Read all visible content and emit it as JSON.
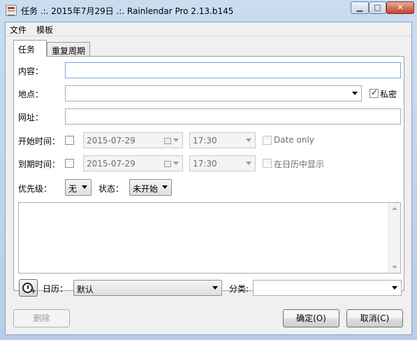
{
  "window": {
    "title": "任务 .:. 2015年7月29日 .:. Rainlendar Pro 2.13.b145"
  },
  "title_buttons": {
    "minimize": "▁",
    "maximize": "□",
    "close": "✕"
  },
  "menu": {
    "file": "文件",
    "template": "模板"
  },
  "tabs": {
    "task": "任务",
    "repeat": "重复周期"
  },
  "form": {
    "content_label": "内容：",
    "content_value": "",
    "location_label": "地点：",
    "location_value": "",
    "private_label": "私密",
    "private_checked": true,
    "url_label": "网址：",
    "url_value": "",
    "start_label": "开始时间：",
    "start_date": "2015-07-29",
    "start_time": "17:30",
    "date_only_label": "Date only",
    "due_label": "到期时间：",
    "due_date": "2015-07-29",
    "due_time": "17:30",
    "show_in_calendar_label": "在日历中显示",
    "priority_label": "优先级：",
    "priority_value": "无",
    "status_label": "状态：",
    "status_value": "未开始",
    "notes_value": ""
  },
  "bottom": {
    "calendar_label": "日历：",
    "calendar_value": "默认",
    "category_label": "分类:",
    "category_value": ""
  },
  "buttons": {
    "delete": "删除",
    "ok": "确定(O)",
    "cancel": "取消(C)"
  }
}
